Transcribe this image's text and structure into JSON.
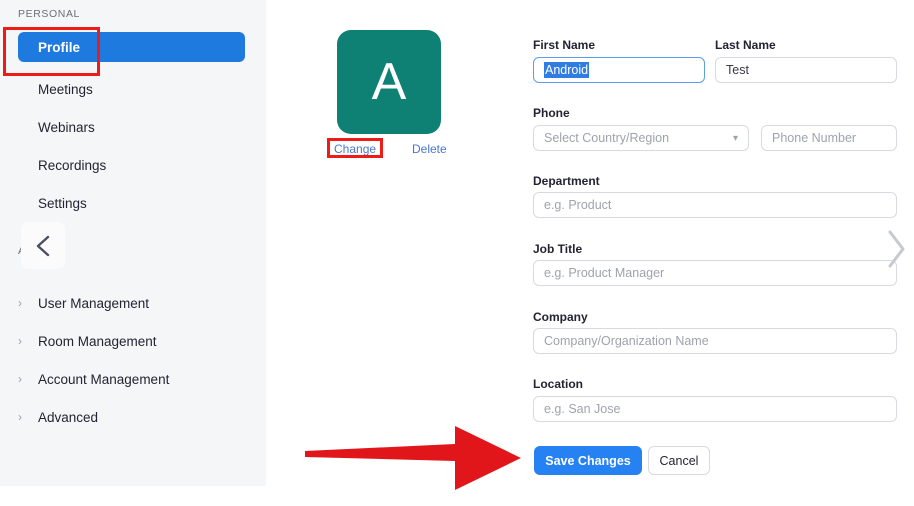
{
  "sidebar": {
    "personal_label": "PERSONAL",
    "admin_label": "ADMIN",
    "collapse_icon": "chevron-left-icon",
    "personal_items": [
      {
        "label": "Profile",
        "active": true
      },
      {
        "label": "Meetings",
        "active": false
      },
      {
        "label": "Webinars",
        "active": false
      },
      {
        "label": "Recordings",
        "active": false
      },
      {
        "label": "Settings",
        "active": false
      }
    ],
    "admin_items": [
      {
        "label": "User Management",
        "chevron": "›"
      },
      {
        "label": "Room Management",
        "chevron": "›"
      },
      {
        "label": "Account Management",
        "chevron": "›"
      },
      {
        "label": "Advanced",
        "chevron": "›"
      }
    ]
  },
  "avatar": {
    "initial": "A",
    "color": "#0e8074",
    "change_label": "Change",
    "delete_label": "Delete"
  },
  "form": {
    "first_name": {
      "label": "First Name",
      "value": "Android",
      "selected": true
    },
    "last_name": {
      "label": "Last Name",
      "value": "Test"
    },
    "phone": {
      "label": "Phone",
      "country_placeholder": "Select Country/Region",
      "number_placeholder": "Phone Number",
      "dropdown_icon": "chevron-down-icon"
    },
    "department": {
      "label": "Department",
      "placeholder": "e.g. Product"
    },
    "job_title": {
      "label": "Job Title",
      "placeholder": "e.g. Product Manager"
    },
    "company": {
      "label": "Company",
      "placeholder": "Company/Organization Name"
    },
    "location": {
      "label": "Location",
      "placeholder": "e.g. San Jose"
    }
  },
  "actions": {
    "save_label": "Save Changes",
    "cancel_label": "Cancel"
  },
  "page_nav": {
    "next_icon": "chevron-right-icon"
  },
  "annotations": {
    "highlight_color": "#ee1c17",
    "arrow_color": "#e0161a",
    "boxes": [
      "profile-nav-item",
      "avatar-change-link"
    ],
    "arrow_target": "save-changes-button"
  },
  "colors": {
    "accent_blue": "#2681f2",
    "sidebar_bg": "#f5f6f8",
    "avatar_teal": "#0e8074",
    "annotation_red": "#ee1c17"
  }
}
